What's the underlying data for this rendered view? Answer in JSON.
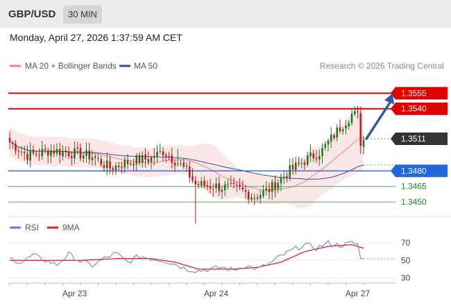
{
  "header": {
    "symbol": "GBP/USD",
    "timeframe": "30 MIN"
  },
  "datetime": "Monday, April 27, 2026 1:37:59 AM CET",
  "legend": {
    "items": [
      {
        "label": "MA 20 + Bollinger Bands",
        "color": "#f08080"
      },
      {
        "label": "MA 50",
        "color": "#2f5597"
      }
    ],
    "credit": "Research © 2026 Trading Central"
  },
  "rsi_legend": {
    "items": [
      {
        "label": "RSI",
        "color": "#5b7fd8"
      },
      {
        "label": "9MA",
        "color": "#e02020"
      }
    ]
  },
  "colors": {
    "up": "#1a7a1a",
    "down": "#c21a1a",
    "resistance": "#e00000",
    "support": "#2266dd",
    "target": "#2c5aa0",
    "price_label": "#333333"
  },
  "chart_data": [
    {
      "type": "candlestick",
      "ylim": [
        1.3436,
        1.3578
      ],
      "x_labels": [
        {
          "label": "Apr 23",
          "pos": 22
        },
        {
          "label": "Apr 24",
          "pos": 70
        },
        {
          "label": "Apr 27",
          "pos": 118
        }
      ],
      "candles_count": 121,
      "levels": [
        {
          "value": 1.3555,
          "label": "1.3555",
          "kind": "resistance"
        },
        {
          "value": 1.354,
          "label": "1.3540",
          "kind": "resistance"
        },
        {
          "value": 1.3511,
          "label": "1.3511",
          "kind": "current"
        },
        {
          "value": 1.348,
          "label": "1.3480",
          "kind": "pivot"
        },
        {
          "value": 1.3465,
          "label": "1.3465",
          "kind": "support"
        },
        {
          "value": 1.345,
          "label": "1.3450",
          "kind": "support"
        }
      ],
      "close_anchors": [
        [
          0,
          1.3508
        ],
        [
          6,
          1.3495
        ],
        [
          14,
          1.35
        ],
        [
          22,
          1.3497
        ],
        [
          28,
          1.3494
        ],
        [
          34,
          1.3483
        ],
        [
          42,
          1.349
        ],
        [
          48,
          1.3492
        ],
        [
          52,
          1.3499
        ],
        [
          57,
          1.3488
        ],
        [
          60,
          1.348
        ],
        [
          63,
          1.3467
        ],
        [
          70,
          1.3465
        ],
        [
          78,
          1.3462
        ],
        [
          83,
          1.3455
        ],
        [
          88,
          1.3462
        ],
        [
          94,
          1.3478
        ],
        [
          100,
          1.349
        ],
        [
          106,
          1.35
        ],
        [
          112,
          1.3522
        ],
        [
          116,
          1.3535
        ],
        [
          118,
          1.3533
        ],
        [
          119,
          1.3508
        ],
        [
          120,
          1.351
        ]
      ],
      "target_arrow": {
        "from": [
          120,
          1.3511
        ],
        "to": [
          122,
          1.3555
        ]
      }
    },
    {
      "type": "line",
      "title": "RSI",
      "ylim": [
        24,
        78
      ],
      "y_ticks": [
        70,
        50,
        30
      ],
      "rsi_anchors": [
        [
          0,
          52
        ],
        [
          4,
          48
        ],
        [
          8,
          56
        ],
        [
          12,
          50
        ],
        [
          16,
          45
        ],
        [
          20,
          57
        ],
        [
          24,
          49
        ],
        [
          28,
          44
        ],
        [
          32,
          52
        ],
        [
          36,
          58
        ],
        [
          40,
          48
        ],
        [
          44,
          55
        ],
        [
          48,
          52
        ],
        [
          52,
          50
        ],
        [
          56,
          46
        ],
        [
          60,
          40
        ],
        [
          64,
          38
        ],
        [
          68,
          40
        ],
        [
          72,
          42
        ],
        [
          76,
          39
        ],
        [
          80,
          44
        ],
        [
          84,
          40
        ],
        [
          88,
          46
        ],
        [
          92,
          55
        ],
        [
          96,
          62
        ],
        [
          100,
          68
        ],
        [
          104,
          64
        ],
        [
          108,
          70
        ],
        [
          112,
          67
        ],
        [
          116,
          70
        ],
        [
          118,
          69
        ],
        [
          119,
          52
        ],
        [
          120,
          52
        ]
      ],
      "ma9_anchors": [
        [
          0,
          50
        ],
        [
          12,
          50
        ],
        [
          24,
          50
        ],
        [
          36,
          52
        ],
        [
          48,
          52
        ],
        [
          56,
          48
        ],
        [
          64,
          40
        ],
        [
          76,
          40
        ],
        [
          84,
          42
        ],
        [
          92,
          48
        ],
        [
          100,
          60
        ],
        [
          108,
          66
        ],
        [
          116,
          68
        ],
        [
          120,
          64
        ]
      ]
    }
  ]
}
